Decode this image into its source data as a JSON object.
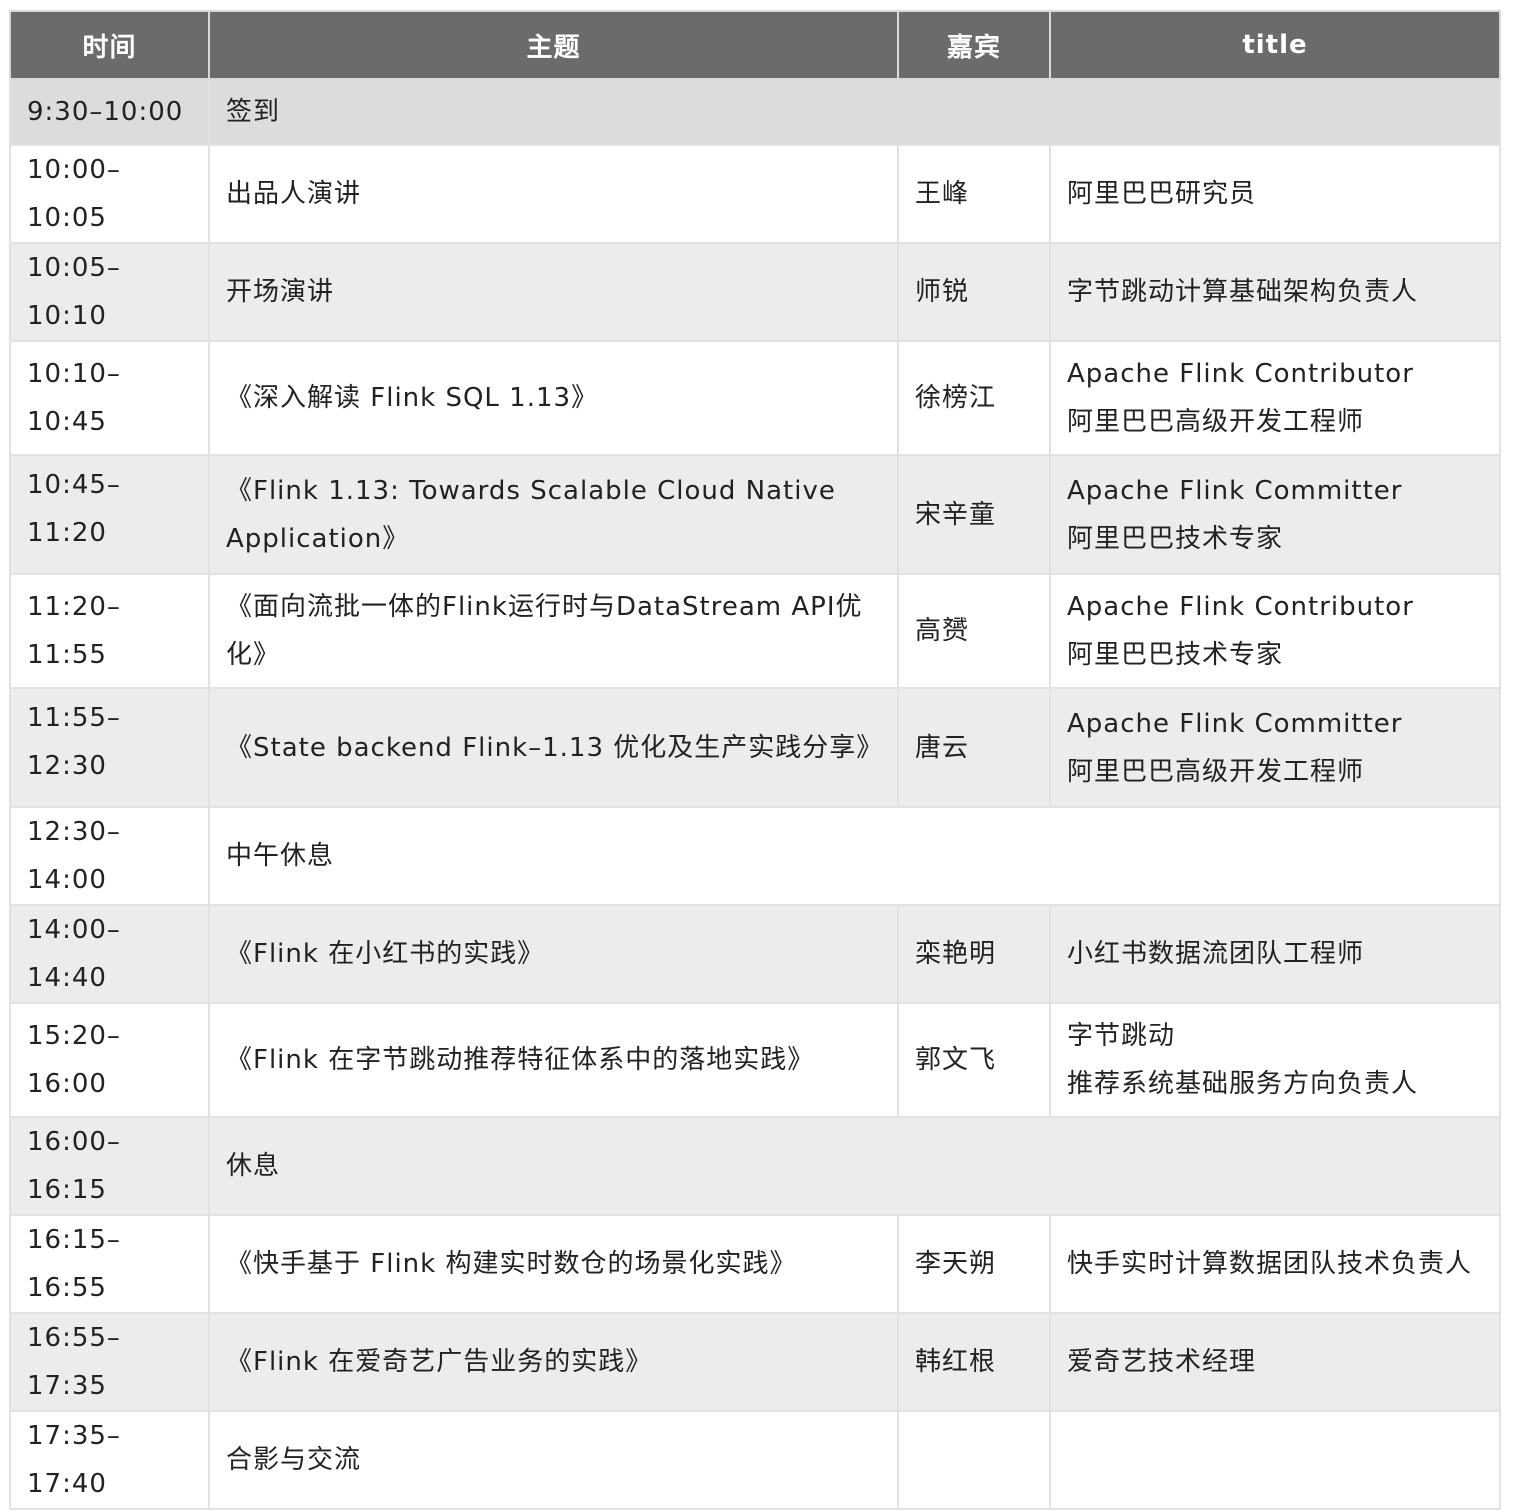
{
  "headers": {
    "time": "时间",
    "topic": "主题",
    "guest": "嘉宾",
    "title": "title"
  },
  "rows": [
    {
      "time": "9:30–10:00",
      "topic": "签到"
    },
    {
      "time": "10:00–10:05",
      "topic": "出品人演讲",
      "guest": "王峰",
      "title": [
        "阿里巴巴研究员"
      ]
    },
    {
      "time": "10:05–10:10",
      "topic": "开场演讲",
      "guest": "师锐",
      "title": [
        "字节跳动计算基础架构负责人"
      ]
    },
    {
      "time": "10:10–10:45",
      "topic": [
        "《深入解读 Flink SQL 1.13》"
      ],
      "guest": "徐榜江",
      "title": [
        "Apache Flink Contributor",
        "阿里巴巴高级开发工程师"
      ]
    },
    {
      "time": "10:45–11:20",
      "topic": [
        "《Flink 1.13: Towards Scalable Cloud Native",
        "Application》"
      ],
      "guest": "宋辛童",
      "title": [
        "Apache Flink Committer",
        "阿里巴巴技术专家"
      ]
    },
    {
      "time": "11:20–11:55",
      "topic": [
        "《面向流批一体的Flink运行时与DataStream API优",
        "化》"
      ],
      "guest": "高赟",
      "title": [
        "Apache Flink Contributor",
        "阿里巴巴技术专家"
      ]
    },
    {
      "time": "11:55–12:30",
      "topic": [
        "《State backend Flink–1.13 优化及生产实践分享》"
      ],
      "guest": "唐云",
      "title": [
        "Apache Flink Committer",
        "阿里巴巴高级开发工程师"
      ]
    },
    {
      "time": "12:30–14:00",
      "topic": "中午休息"
    },
    {
      "time": "14:00–14:40",
      "topic": "《Flink 在小红书的实践》",
      "guest": "栾艳明",
      "title": [
        "小红书数据流团队工程师"
      ]
    },
    {
      "time": "15:20–16:00",
      "topic": [
        "《Flink 在字节跳动推荐特征体系中的落地实践》"
      ],
      "guest": "郭文飞",
      "title": [
        "字节跳动",
        "推荐系统基础服务方向负责人"
      ]
    },
    {
      "time": "16:00–16:15",
      "topic": "休息"
    },
    {
      "time": "16:15–16:55",
      "topic": "《快手基于 Flink 构建实时数仓的场景化实践》",
      "guest": "李天朔",
      "title": [
        "快手实时计算数据团队技术负责人"
      ]
    },
    {
      "time": "16:55–17:35",
      "topic": "《Flink 在爱奇艺广告业务的实践》",
      "guest": "韩红根",
      "title": [
        "爱奇艺技术经理"
      ]
    },
    {
      "time": "17:35–17:40",
      "topic": "合影与交流",
      "guest": "",
      "title": [
        ""
      ]
    }
  ]
}
